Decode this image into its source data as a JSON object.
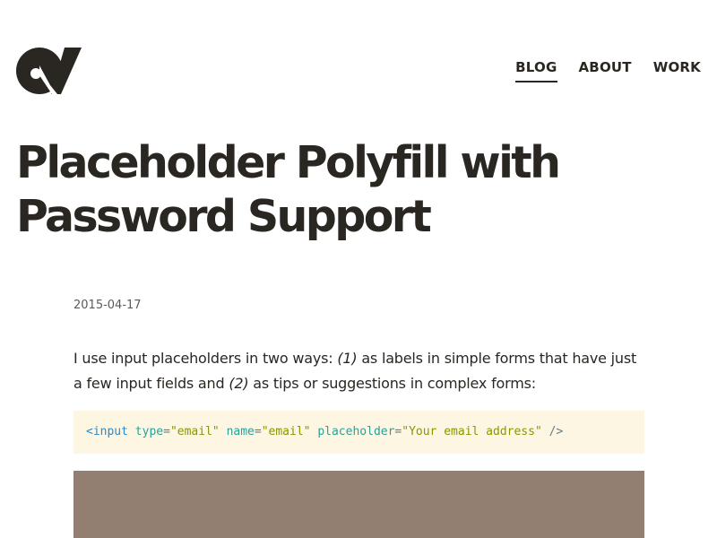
{
  "colors": {
    "text": "#2a2621",
    "muted": "#5e5a55",
    "code_background": "#fdf6e3",
    "figure_background": "#927f71"
  },
  "header": {
    "logo_icon": "site-logo",
    "nav": [
      {
        "label": "BLOG",
        "active": true
      },
      {
        "label": "ABOUT",
        "active": false
      },
      {
        "label": "WORK",
        "active": false
      }
    ]
  },
  "article": {
    "title_line1": "Placeholder Polyfill with",
    "title_line2": "Password Support",
    "date": "2015-04-17",
    "intro": {
      "part1": "I use input placeholders in two ways: ",
      "em1": "(1)",
      "part2": " as labels in simple forms that have just a few input fields and ",
      "em2": "(2)",
      "part3": " as tips or suggestions in complex forms:"
    },
    "code": {
      "open": "<",
      "tag": "input",
      "attr1": "type",
      "val1": "\"email\"",
      "attr2": "name",
      "val2": "\"email\"",
      "attr3": "placeholder",
      "val3": "\"Your email address\"",
      "close": " />"
    }
  }
}
